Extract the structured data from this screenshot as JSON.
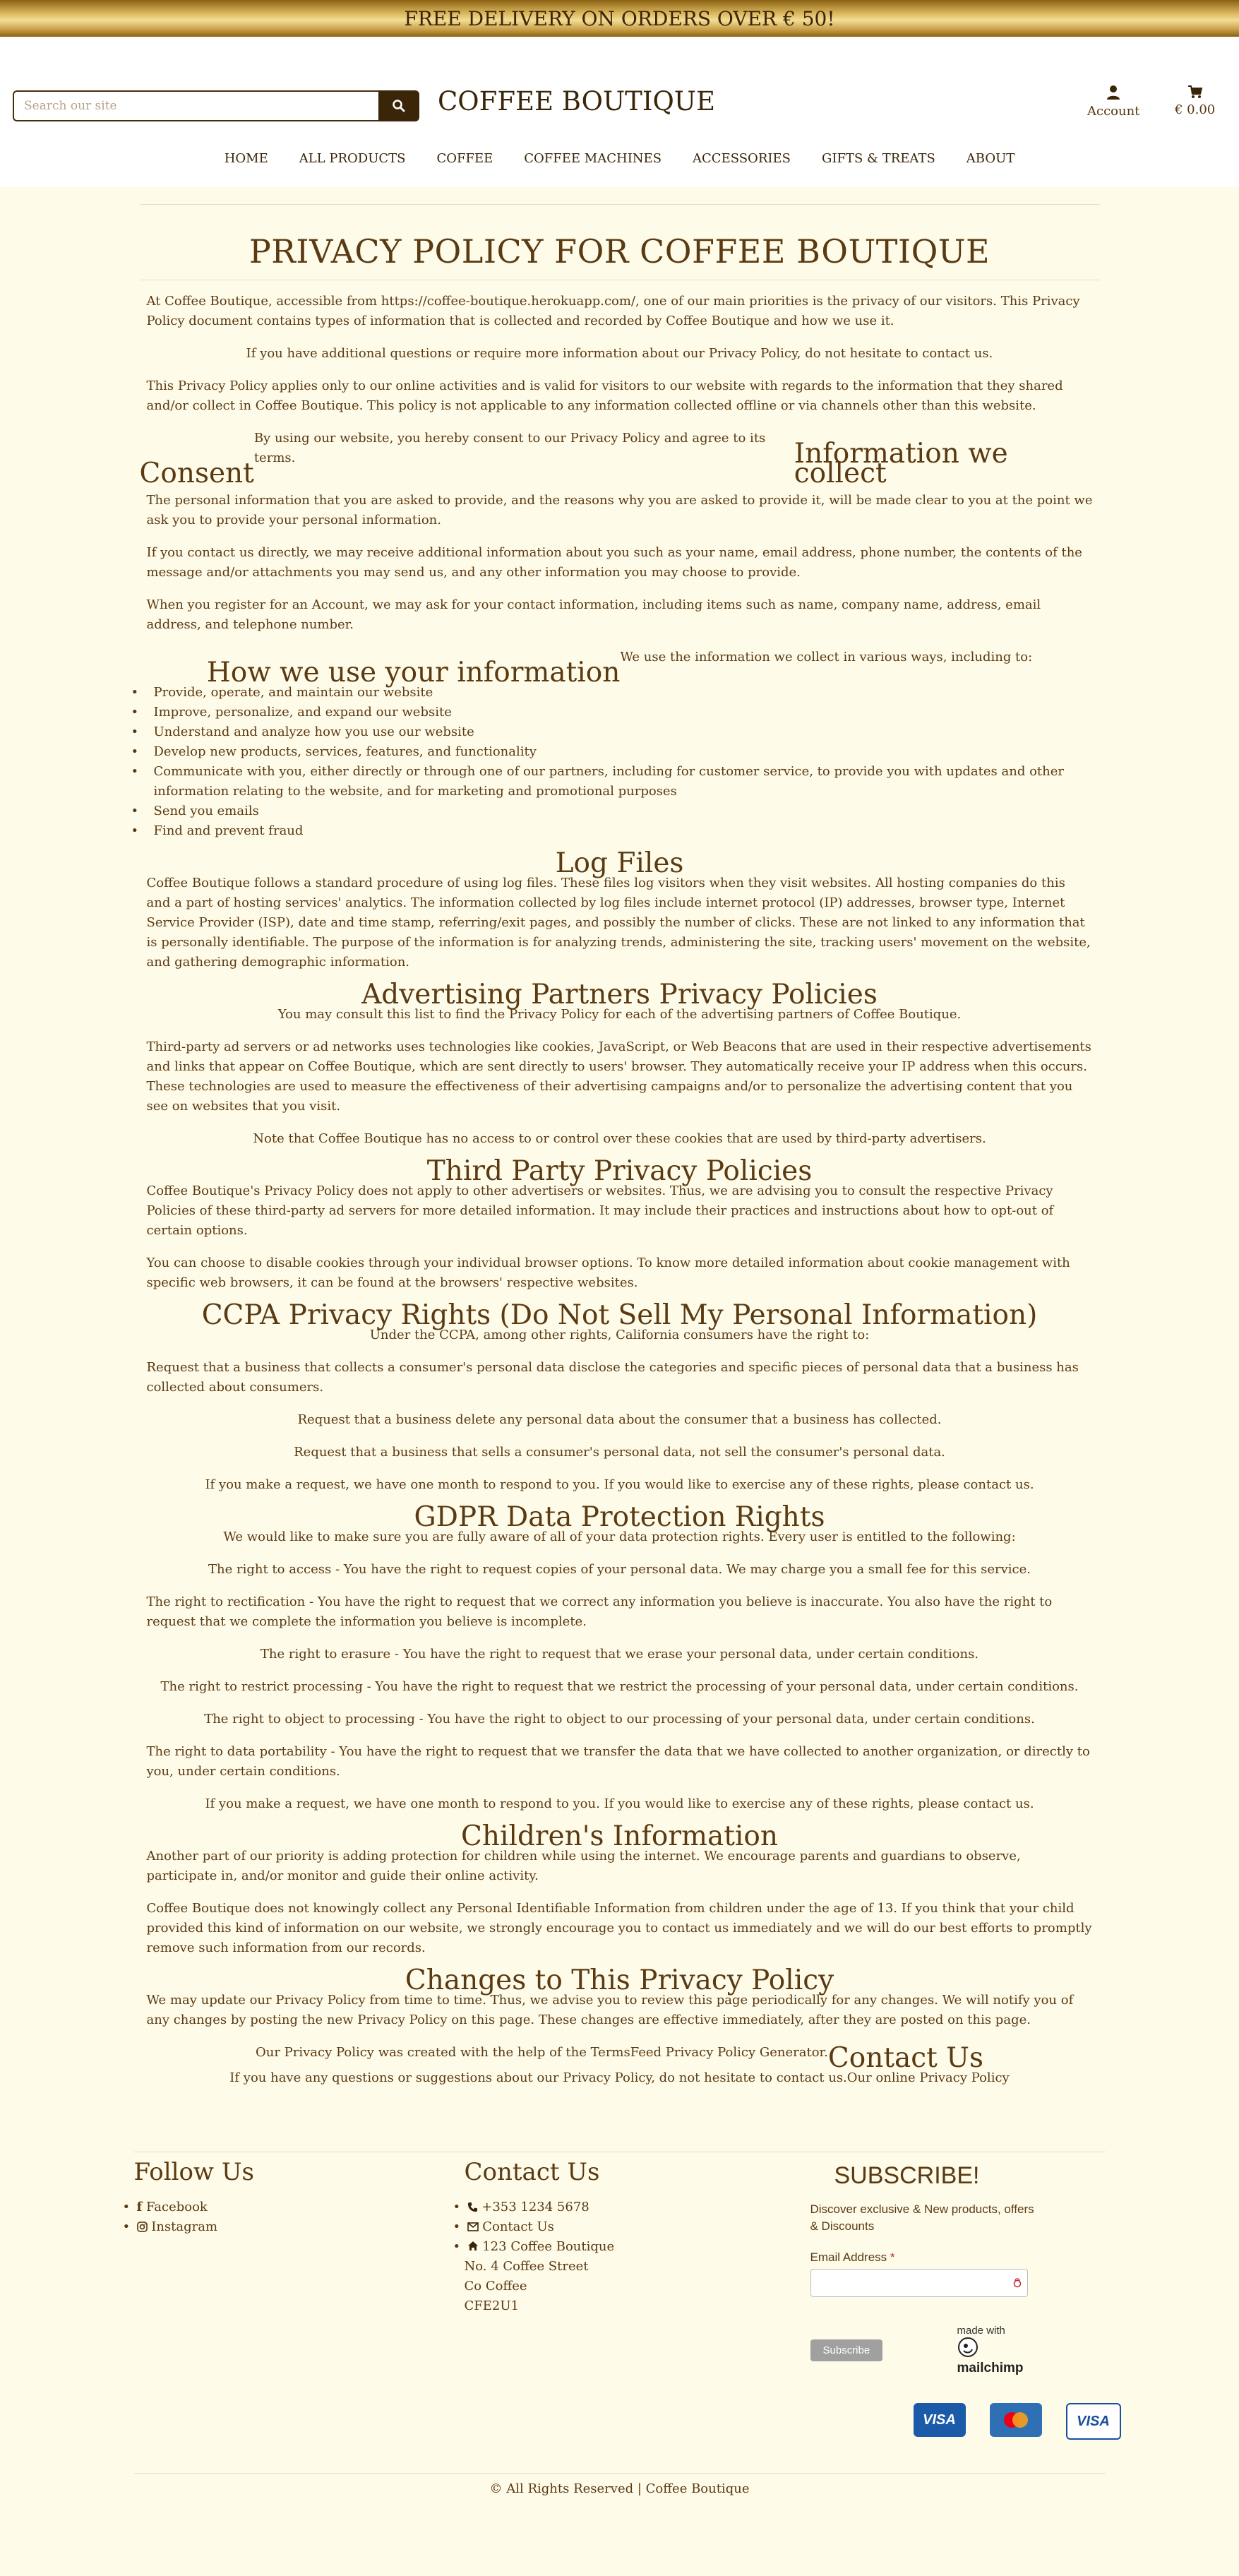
{
  "banner": {
    "text": "FREE DELIVERY ON ORDERS OVER € 50!"
  },
  "header": {
    "search_placeholder": "Search our site",
    "brand": "COFFEE BOUTIQUE",
    "account_label": "Account",
    "cart_total": "€ 0.00"
  },
  "nav": [
    "HOME",
    "ALL PRODUCTS",
    "COFFEE",
    "COFFEE MACHINES",
    "ACCESSORIES",
    "GIFTS & TREATS",
    "ABOUT"
  ],
  "page": {
    "title": "PRIVACY POLICY FOR COFFEE BOUTIQUE",
    "intro1": "At Coffee Boutique, accessible from https://coffee-boutique.herokuapp.com/, one of our main priorities is the privacy of our visitors. This Privacy Policy document contains types of information that is collected and recorded by Coffee Boutique and how we use it.",
    "intro2": "If you have additional questions or require more information about our Privacy Policy, do not hesitate to contact us.",
    "intro3": "This Privacy Policy applies only to our online activities and is valid for visitors to our website with regards to the information that they shared and/or collect in Coffee Boutique. This policy is not applicable to any information collected offline or via channels other than this website.",
    "consent_heading": "Consent",
    "consent_text": "By using our website, you hereby consent to our Privacy Policy and agree to its terms.",
    "info_heading": "Information we collect",
    "info1": "The personal information that you are asked to provide, and the reasons why you are asked to provide it, will be made clear to you at the point we ask you to provide your personal information.",
    "info2": "If you contact us directly, we may receive additional information about you such as your name, email address, phone number, the contents of the message and/or attachments you may send us, and any other information you may choose to provide.",
    "info3": "When you register for an Account, we may ask for your contact information, including items such as name, company name, address, email address, and telephone number.",
    "use_heading": "How we use your information",
    "use_intro": "We use the information we collect in various ways, including to:",
    "use_items": [
      "Provide, operate, and maintain our website",
      "Improve, personalize, and expand our website",
      "Understand and analyze how you use our website",
      "Develop new products, services, features, and functionality",
      "Communicate with you, either directly or through one of our partners, including for customer service, to provide you with updates and other information relating to the website, and for marketing and promotional purposes",
      "Send you emails",
      "Find and prevent fraud"
    ],
    "log_heading": "Log Files",
    "log_text": "Coffee Boutique follows a standard procedure of using log files. These files log visitors when they visit websites. All hosting companies do this and a part of hosting services' analytics. The information collected by log files include internet protocol (IP) addresses, browser type, Internet Service Provider (ISP), date and time stamp, referring/exit pages, and possibly the number of clicks. These are not linked to any information that is personally identifiable. The purpose of the information is for analyzing trends, administering the site, tracking users' movement on the website, and gathering demographic information.",
    "adv_heading": "Advertising Partners Privacy Policies",
    "adv1": "You may consult this list to find the Privacy Policy for each of the advertising partners of Coffee Boutique.",
    "adv2": "Third-party ad servers or ad networks uses technologies like cookies, JavaScript, or Web Beacons that are used in their respective advertisements and links that appear on Coffee Boutique, which are sent directly to users' browser. They automatically receive your IP address when this occurs. These technologies are used to measure the effectiveness of their advertising campaigns and/or to personalize the advertising content that you see on websites that you visit.",
    "adv3": "Note that Coffee Boutique has no access to or control over these cookies that are used by third-party advertisers.",
    "third_heading": "Third Party Privacy Policies",
    "third1": "Coffee Boutique's Privacy Policy does not apply to other advertisers or websites. Thus, we are advising you to consult the respective Privacy Policies of these third-party ad servers for more detailed information. It may include their practices and instructions about how to opt-out of certain options.",
    "third2": "You can choose to disable cookies through your individual browser options. To know more detailed information about cookie management with specific web browsers, it can be found at the browsers' respective websites.",
    "ccpa_heading": "CCPA Privacy Rights (Do Not Sell My Personal Information)",
    "ccpa1": "Under the CCPA, among other rights, California consumers have the right to:",
    "ccpa2": "Request that a business that collects a consumer's personal data disclose the categories and specific pieces of personal data that a business has collected about consumers.",
    "ccpa3": "Request that a business delete any personal data about the consumer that a business has collected.",
    "ccpa4": "Request that a business that sells a consumer's personal data, not sell the consumer's personal data.",
    "ccpa5": "If you make a request, we have one month to respond to you. If you would like to exercise any of these rights, please contact us.",
    "gdpr_heading": "GDPR Data Protection Rights",
    "gdpr1": "We would like to make sure you are fully aware of all of your data protection rights. Every user is entitled to the following:",
    "gdpr2": "The right to access - You have the right to request copies of your personal data. We may charge you a small fee for this service.",
    "gdpr3": "The right to rectification - You have the right to request that we correct any information you believe is inaccurate. You also have the right to request that we complete the information you believe is incomplete.",
    "gdpr4": "The right to erasure - You have the right to request that we erase your personal data, under certain conditions.",
    "gdpr5": "The right to restrict processing - You have the right to request that we restrict the processing of your personal data, under certain conditions.",
    "gdpr6": "The right to object to processing - You have the right to object to our processing of your personal data, under certain conditions.",
    "gdpr7": "The right to data portability - You have the right to request that we transfer the data that we have collected to another organization, or directly to you, under certain conditions.",
    "gdpr8": "If you make a request, we have one month to respond to you. If you would like to exercise any of these rights, please contact us.",
    "child_heading": "Children's Information",
    "child1": "Another part of our priority is adding protection for children while using the internet. We encourage parents and guardians to observe, participate in, and/or monitor and guide their online activity.",
    "child2": "Coffee Boutique does not knowingly collect any Personal Identifiable Information from children under the age of 13. If you think that your child provided this kind of information on our website, we strongly encourage you to contact us immediately and we will do our best efforts to promptly remove such information from our records.",
    "changes_heading": "Changes to This Privacy Policy",
    "changes1": "We may update our Privacy Policy from time to time. Thus, we advise you to review this page periodically for any changes. We will notify you of any changes by posting the new Privacy Policy on this page. These changes are effective immediately, after they are posted on this page.",
    "changes2": "Our Privacy Policy was created with the help of the TermsFeed Privacy Policy Generator.",
    "contact_heading": "Contact Us",
    "contact_text": "If you have any questions or suggestions about our Privacy Policy, do not hesitate to contact us.",
    "contact_tail": "Our online Privacy Policy"
  },
  "footer": {
    "follow_heading": "Follow Us",
    "follow_items": [
      "Facebook",
      "Instagram"
    ],
    "contact_heading": "Contact Us",
    "phone": "+353 1234 5678",
    "contact_link": "Contact Us",
    "address_line1": "123 Coffee Boutique",
    "address_line2": "No. 4 Coffee Street",
    "address_line3": "Co Coffee",
    "address_line4": "CFE2U1",
    "subscribe_heading": "SUBSCRIBE!",
    "subscribe_desc": "Discover exclusive & New products, offers & Discounts",
    "email_label": "Email Address",
    "email_required": "*",
    "subscribe_button": "Subscribe",
    "made_with": "made with",
    "mailchimp": "mailchimp",
    "card1": "VISA",
    "card3": "VISA",
    "copyright": "© All Rights Reserved | Coffee Boutique"
  },
  "colors": {
    "background": "#fffbe9",
    "text": "#5a3a12",
    "dark_brown": "#3a2508"
  },
  "icons": {
    "search": "search-icon",
    "account": "user-icon",
    "cart": "cart-icon",
    "facebook": "facebook-icon",
    "instagram": "instagram-icon",
    "phone": "phone-icon",
    "envelope": "envelope-icon",
    "home": "home-icon"
  }
}
